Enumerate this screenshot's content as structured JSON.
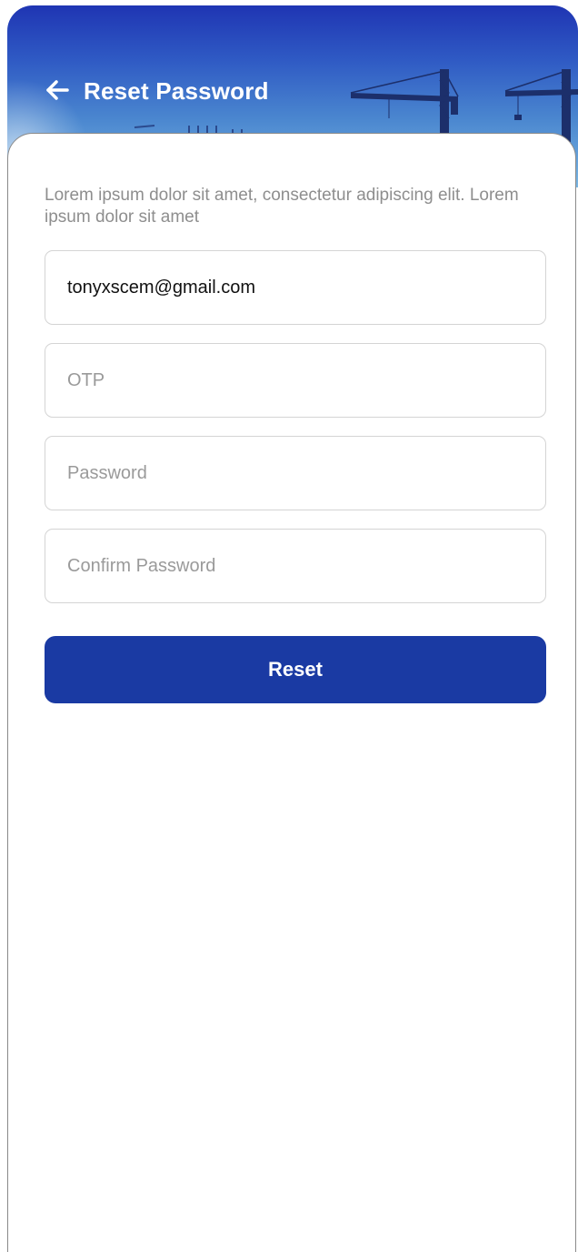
{
  "header": {
    "title": "Reset Password",
    "back_icon": "arrow-left-icon",
    "background_colors": [
      "#1f35b3",
      "#4a86cf",
      "#7ab6e2"
    ]
  },
  "form": {
    "description": "Lorem ipsum dolor sit amet, consectetur adipiscing elit. Lorem ipsum dolor sit amet",
    "email": {
      "value": "tonyxscem@gmail.com",
      "placeholder": ""
    },
    "otp": {
      "value": "",
      "placeholder": "OTP"
    },
    "password": {
      "value": "",
      "placeholder": "Password"
    },
    "confirm_password": {
      "value": "",
      "placeholder": "Confirm Password"
    },
    "submit_label": "Reset",
    "accent_color": "#1a3aa3"
  }
}
